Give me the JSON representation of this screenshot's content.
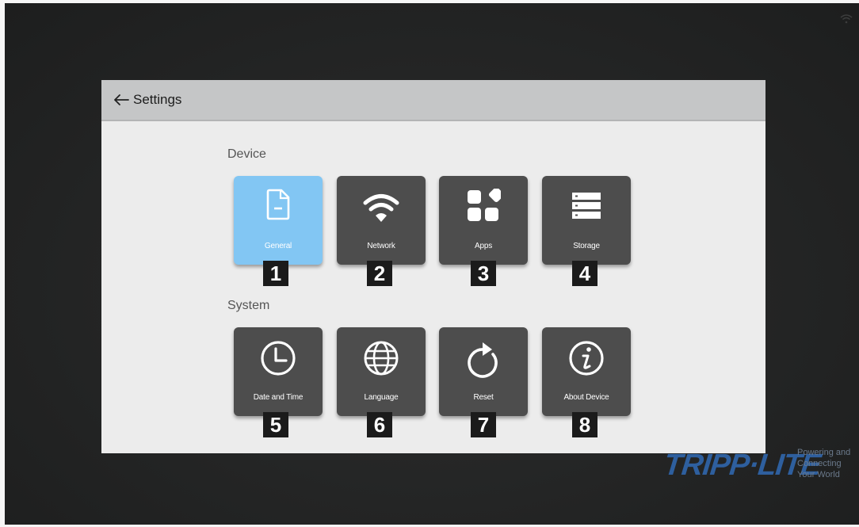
{
  "header": {
    "title": "Settings"
  },
  "sections": {
    "device": {
      "label": "Device",
      "tiles": [
        {
          "label": "General",
          "number": "1",
          "icon": "document-icon",
          "selected": true
        },
        {
          "label": "Network",
          "number": "2",
          "icon": "wifi-icon"
        },
        {
          "label": "Apps",
          "number": "3",
          "icon": "apps-icon"
        },
        {
          "label": "Storage",
          "number": "4",
          "icon": "storage-icon"
        }
      ]
    },
    "system": {
      "label": "System",
      "tiles": [
        {
          "label": "Date and Time",
          "number": "5",
          "icon": "clock-icon"
        },
        {
          "label": "Language",
          "number": "6",
          "icon": "globe-icon"
        },
        {
          "label": "Reset",
          "number": "7",
          "icon": "reset-icon"
        },
        {
          "label": "About Device",
          "number": "8",
          "icon": "info-icon"
        }
      ]
    }
  },
  "brand": {
    "logo": "TRIPP·LITE",
    "tagline": [
      "Powering and",
      "Connecting",
      "Your World"
    ]
  },
  "colors": {
    "tile": "#4d4d4d",
    "tile_selected": "#82c6f3",
    "titlebar": "#c5c6c7",
    "panel": "#ececec",
    "brand_blue": "#2e5f9e"
  }
}
